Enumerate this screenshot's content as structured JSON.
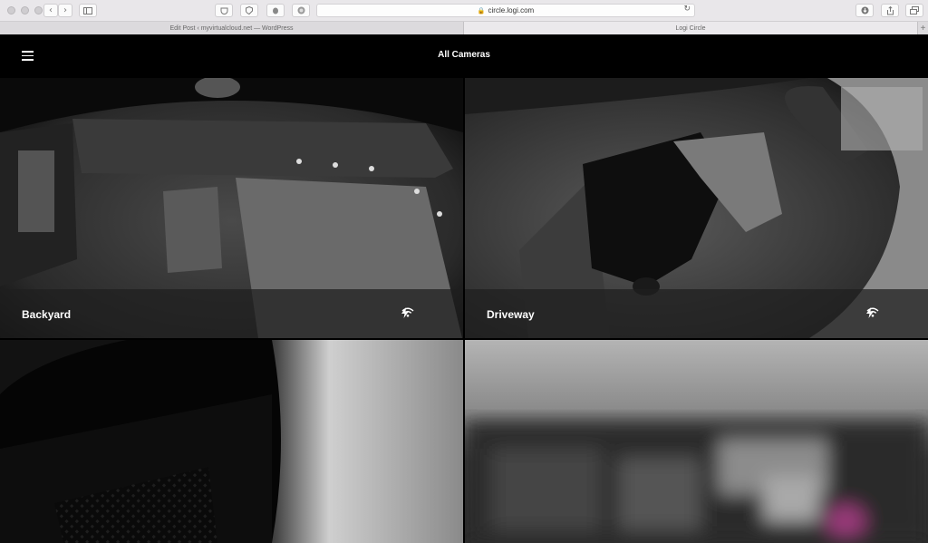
{
  "browser": {
    "address": "circle.logi.com",
    "tabs": [
      {
        "label": "Edit Post ‹ myvirtualcloud.net — WordPress"
      },
      {
        "label": "Logi Circle"
      }
    ],
    "new_tab_glyph": "+",
    "icons": [
      "back-icon",
      "forward-icon",
      "sidebar-icon",
      "pocket-icon",
      "shield-icon",
      "evernote-icon",
      "extension-icon",
      "lock-icon",
      "reload-icon",
      "download-icon",
      "share-icon",
      "tabs-icon"
    ]
  },
  "app": {
    "title": "All Cameras",
    "menu_icon": "hamburger-icon"
  },
  "cameras": [
    {
      "name": "Backyard",
      "icons": [
        "power-bolt-icon",
        "wifi-icon"
      ]
    },
    {
      "name": "Driveway",
      "icons": [
        "power-bolt-icon",
        "wifi-icon"
      ]
    },
    {
      "name": "",
      "icons": []
    },
    {
      "name": "",
      "icons": []
    }
  ]
}
